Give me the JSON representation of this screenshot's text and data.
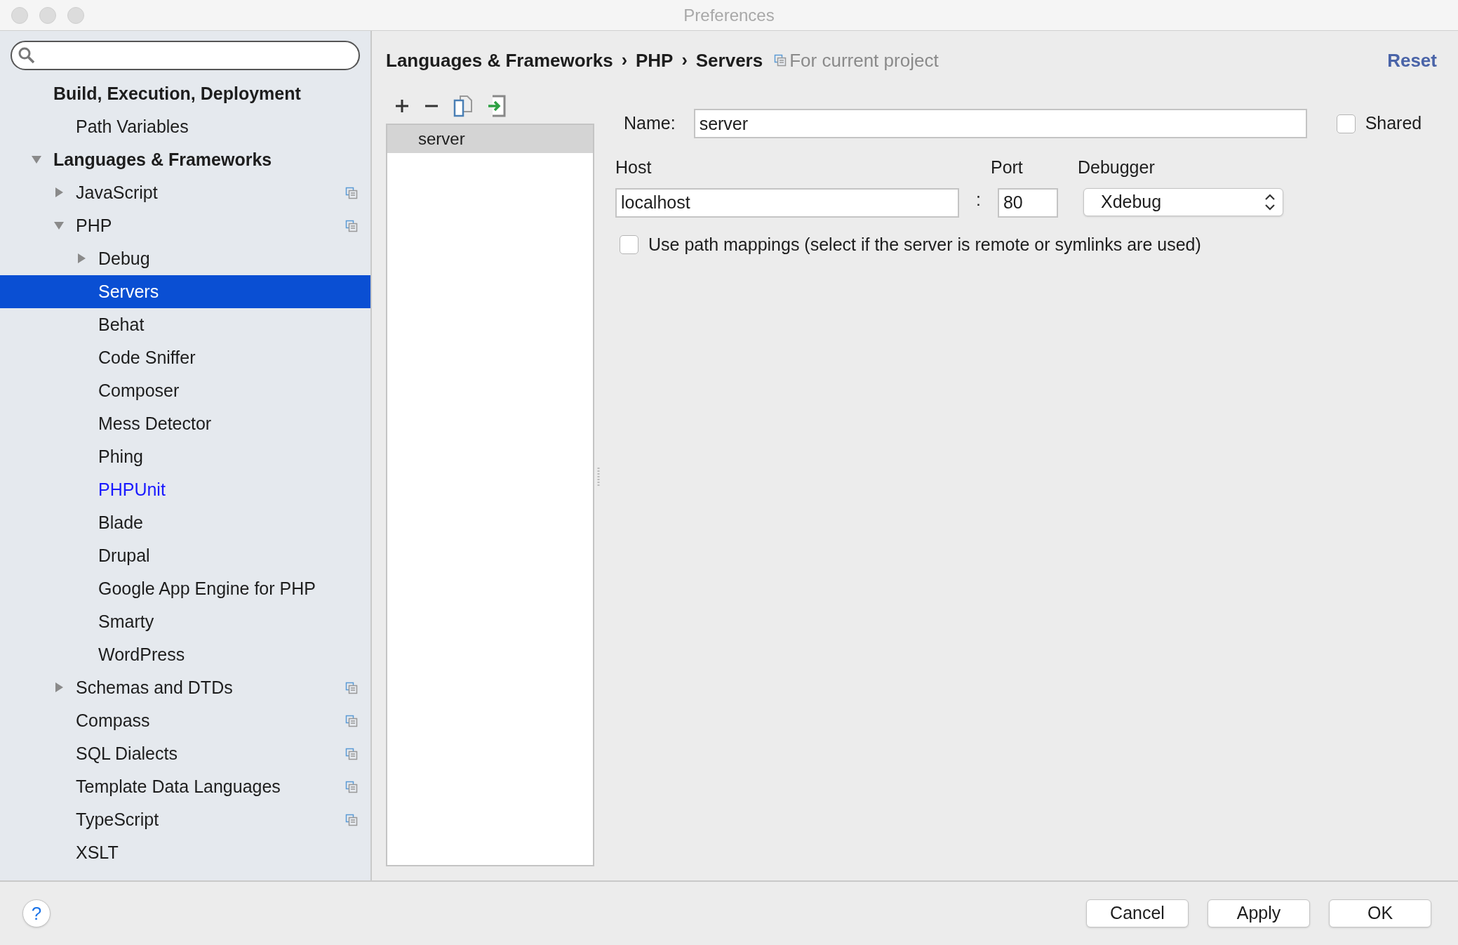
{
  "window": {
    "title": "Preferences"
  },
  "tree": [
    {
      "label": "Build, Execution, Deployment",
      "kind": "leaf",
      "bold": true,
      "selected": false,
      "highlighted": false,
      "project": false,
      "children": [
        {
          "label": "Path Variables",
          "kind": "leaf",
          "bold": false,
          "selected": false,
          "highlighted": false,
          "project": false
        }
      ]
    },
    {
      "label": "Languages & Frameworks",
      "kind": "group",
      "expanded": true,
      "bold": true,
      "selected": false,
      "highlighted": false,
      "project": false,
      "children": [
        {
          "label": "JavaScript",
          "kind": "group",
          "expanded": false,
          "bold": false,
          "selected": false,
          "highlighted": false,
          "project": true
        },
        {
          "label": "PHP",
          "kind": "group",
          "expanded": true,
          "bold": false,
          "selected": false,
          "highlighted": false,
          "project": true,
          "children": [
            {
              "label": "Debug",
              "kind": "group",
              "expanded": false,
              "bold": false,
              "selected": false,
              "highlighted": false,
              "project": false
            },
            {
              "label": "Servers",
              "kind": "leaf",
              "bold": false,
              "selected": true,
              "highlighted": false,
              "project": false
            },
            {
              "label": "Behat",
              "kind": "leaf",
              "bold": false,
              "selected": false,
              "highlighted": false,
              "project": false
            },
            {
              "label": "Code Sniffer",
              "kind": "leaf",
              "bold": false,
              "selected": false,
              "highlighted": false,
              "project": false
            },
            {
              "label": "Composer",
              "kind": "leaf",
              "bold": false,
              "selected": false,
              "highlighted": false,
              "project": false
            },
            {
              "label": "Mess Detector",
              "kind": "leaf",
              "bold": false,
              "selected": false,
              "highlighted": false,
              "project": false
            },
            {
              "label": "Phing",
              "kind": "leaf",
              "bold": false,
              "selected": false,
              "highlighted": false,
              "project": false
            },
            {
              "label": "PHPUnit",
              "kind": "leaf",
              "bold": false,
              "selected": false,
              "highlighted": true,
              "project": false
            },
            {
              "label": "Blade",
              "kind": "leaf",
              "bold": false,
              "selected": false,
              "highlighted": false,
              "project": false
            },
            {
              "label": "Drupal",
              "kind": "leaf",
              "bold": false,
              "selected": false,
              "highlighted": false,
              "project": false
            },
            {
              "label": "Google App Engine for PHP",
              "kind": "leaf",
              "bold": false,
              "selected": false,
              "highlighted": false,
              "project": false
            },
            {
              "label": "Smarty",
              "kind": "leaf",
              "bold": false,
              "selected": false,
              "highlighted": false,
              "project": false
            },
            {
              "label": "WordPress",
              "kind": "leaf",
              "bold": false,
              "selected": false,
              "highlighted": false,
              "project": false
            }
          ]
        },
        {
          "label": "Schemas and DTDs",
          "kind": "group",
          "expanded": false,
          "bold": false,
          "selected": false,
          "highlighted": false,
          "project": true
        },
        {
          "label": "Compass",
          "kind": "leaf",
          "bold": false,
          "selected": false,
          "highlighted": false,
          "project": true
        },
        {
          "label": "SQL Dialects",
          "kind": "leaf",
          "bold": false,
          "selected": false,
          "highlighted": false,
          "project": true
        },
        {
          "label": "Template Data Languages",
          "kind": "leaf",
          "bold": false,
          "selected": false,
          "highlighted": false,
          "project": true
        },
        {
          "label": "TypeScript",
          "kind": "leaf",
          "bold": false,
          "selected": false,
          "highlighted": false,
          "project": true
        },
        {
          "label": "XSLT",
          "kind": "leaf",
          "bold": false,
          "selected": false,
          "highlighted": false,
          "project": false
        }
      ]
    }
  ],
  "breadcrumb": [
    "Languages & Frameworks",
    "PHP",
    "Servers"
  ],
  "breadcrumb_separator": "›",
  "scope_note": "For current project",
  "reset": "Reset",
  "servers": [
    {
      "label": "server",
      "selected": true
    }
  ],
  "form": {
    "name_label": "Name:",
    "name_value": "server",
    "shared_label": "Shared",
    "shared_checked": false,
    "host_label": "Host",
    "host_value": "localhost",
    "colon": ":",
    "port_label": "Port",
    "port_value": "80",
    "debugger_label": "Debugger",
    "debugger_value": "Xdebug",
    "mappings_label": "Use path mappings (select if the server is remote or symlinks are used)",
    "mappings_checked": false
  },
  "help": "?",
  "buttons": [
    "Cancel",
    "Apply",
    "OK"
  ]
}
